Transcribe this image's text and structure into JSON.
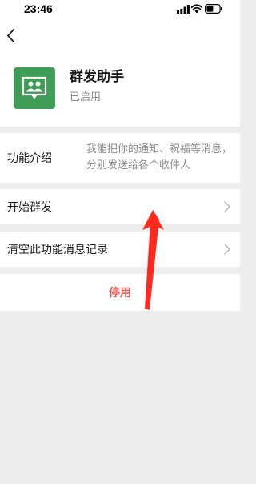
{
  "status_bar": {
    "time": "23:46"
  },
  "nav": {
    "back_icon": "chevron-left-icon"
  },
  "app": {
    "name": "群发助手",
    "status": "已启用",
    "logo_icon": "group-chat-icon",
    "logo_color": "#3f9d55"
  },
  "intro": {
    "label": "功能介绍",
    "description": "我能把你的通知、祝福等消息，分别发送给各个收件人"
  },
  "menu": {
    "start_label": "开始群发",
    "clear_label": "清空此功能消息记录"
  },
  "disable": {
    "label": "停用",
    "color": "#e05d5a"
  },
  "annotation": {
    "arrow_color": "#ff2a1f"
  }
}
